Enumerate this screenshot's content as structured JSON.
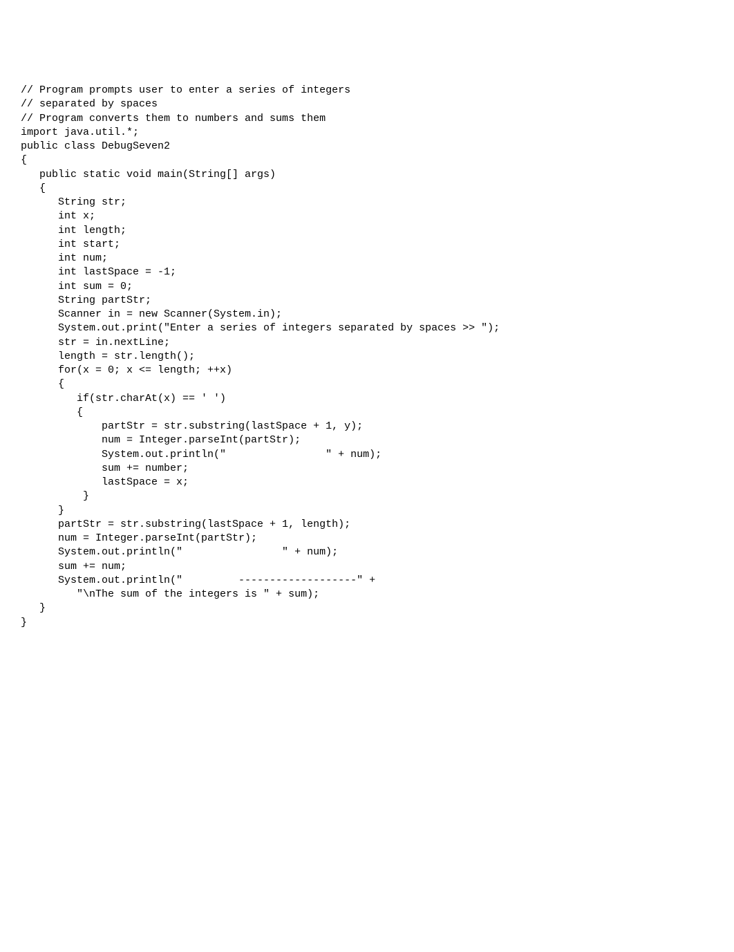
{
  "code": {
    "lines": [
      "// Program prompts user to enter a series of integers",
      "// separated by spaces",
      "// Program converts them to numbers and sums them",
      "import java.util.*;",
      "public class DebugSeven2",
      "{",
      "   public static void main(String[] args)",
      "   {",
      "      String str;",
      "      int x;",
      "      int length;",
      "      int start;",
      "      int num;",
      "      int lastSpace = -1;",
      "      int sum = 0;",
      "      String partStr;",
      "      Scanner in = new Scanner(System.in);",
      "      System.out.print(\"Enter a series of integers separated by spaces >> \");",
      "      str = in.nextLine;",
      "      length = str.length();",
      "      for(x = 0; x <= length; ++x)",
      "      {",
      "         if(str.charAt(x) == ' ')",
      "         {",
      "             partStr = str.substring(lastSpace + 1, y);",
      "             num = Integer.parseInt(partStr);",
      "             System.out.println(\"                \" + num);",
      "             sum += number;",
      "             lastSpace = x;",
      "          }",
      "      }",
      "      partStr = str.substring(lastSpace + 1, length);",
      "      num = Integer.parseInt(partStr);",
      "      System.out.println(\"                \" + num);",
      "      sum += num;",
      "      System.out.println(\"         -------------------\" +",
      "         \"\\nThe sum of the integers is \" + sum);",
      "   }",
      "}"
    ]
  }
}
